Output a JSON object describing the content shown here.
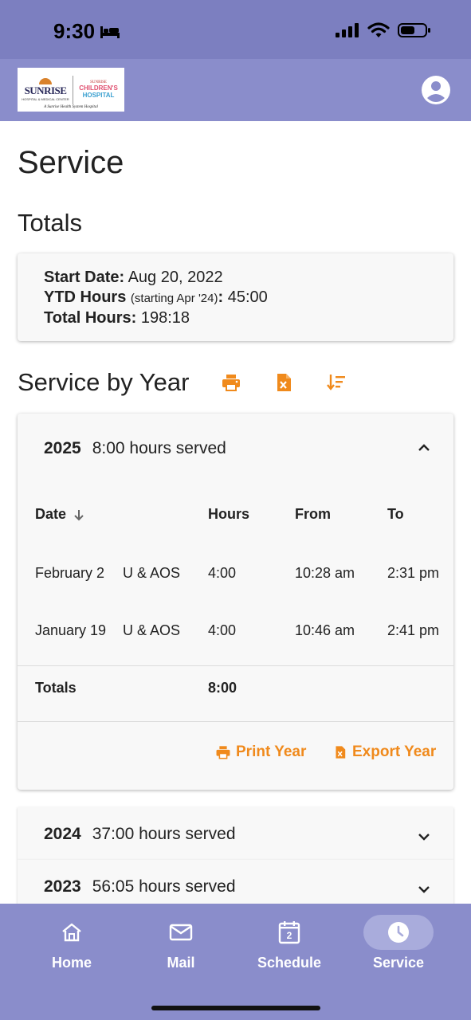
{
  "status": {
    "time": "9:30"
  },
  "header": {
    "logo": {
      "sunrise": "SUNRISE",
      "sunrise_sub": "HOSPITAL & MEDICAL CENTER",
      "children_sunrise": "SUNRISE",
      "children": "CHILDREN'S",
      "hospital": "HOSPITAL",
      "tagline": "A Sunrise Health System Hospital"
    }
  },
  "page": {
    "title": "Service",
    "totals_heading": "Totals",
    "totals": {
      "start_label": "Start Date:",
      "start_value": "Aug 20, 2022",
      "ytd_label": "YTD Hours",
      "ytd_note": "(starting Apr '24)",
      "ytd_colon": ":",
      "ytd_value": "45:00",
      "total_label": "Total Hours:",
      "total_value": "198:18"
    },
    "service_by_year_heading": "Service by Year"
  },
  "years": {
    "y2025": {
      "year": "2025",
      "summary": "8:00 hours served",
      "columns": {
        "date": "Date",
        "hours": "Hours",
        "from": "From",
        "to": "To"
      },
      "rows": [
        {
          "date": "February 2",
          "type": "U & AOS",
          "hours": "4:00",
          "from": "10:28 am",
          "to": "2:31 pm"
        },
        {
          "date": "January 19",
          "type": "U & AOS",
          "hours": "4:00",
          "from": "10:46 am",
          "to": "2:41 pm"
        }
      ],
      "totals_label": "Totals",
      "totals_hours": "8:00",
      "print_label": "Print Year",
      "export_label": "Export Year"
    },
    "y2024": {
      "year": "2024",
      "summary": "37:00 hours served"
    },
    "y2023": {
      "year": "2023",
      "summary": "56:05 hours served"
    }
  },
  "nav": {
    "home": "Home",
    "mail": "Mail",
    "schedule": "Schedule",
    "schedule_day": "2",
    "service": "Service"
  },
  "colors": {
    "accent": "#f08a1c",
    "bar": "#8a8dcb"
  }
}
